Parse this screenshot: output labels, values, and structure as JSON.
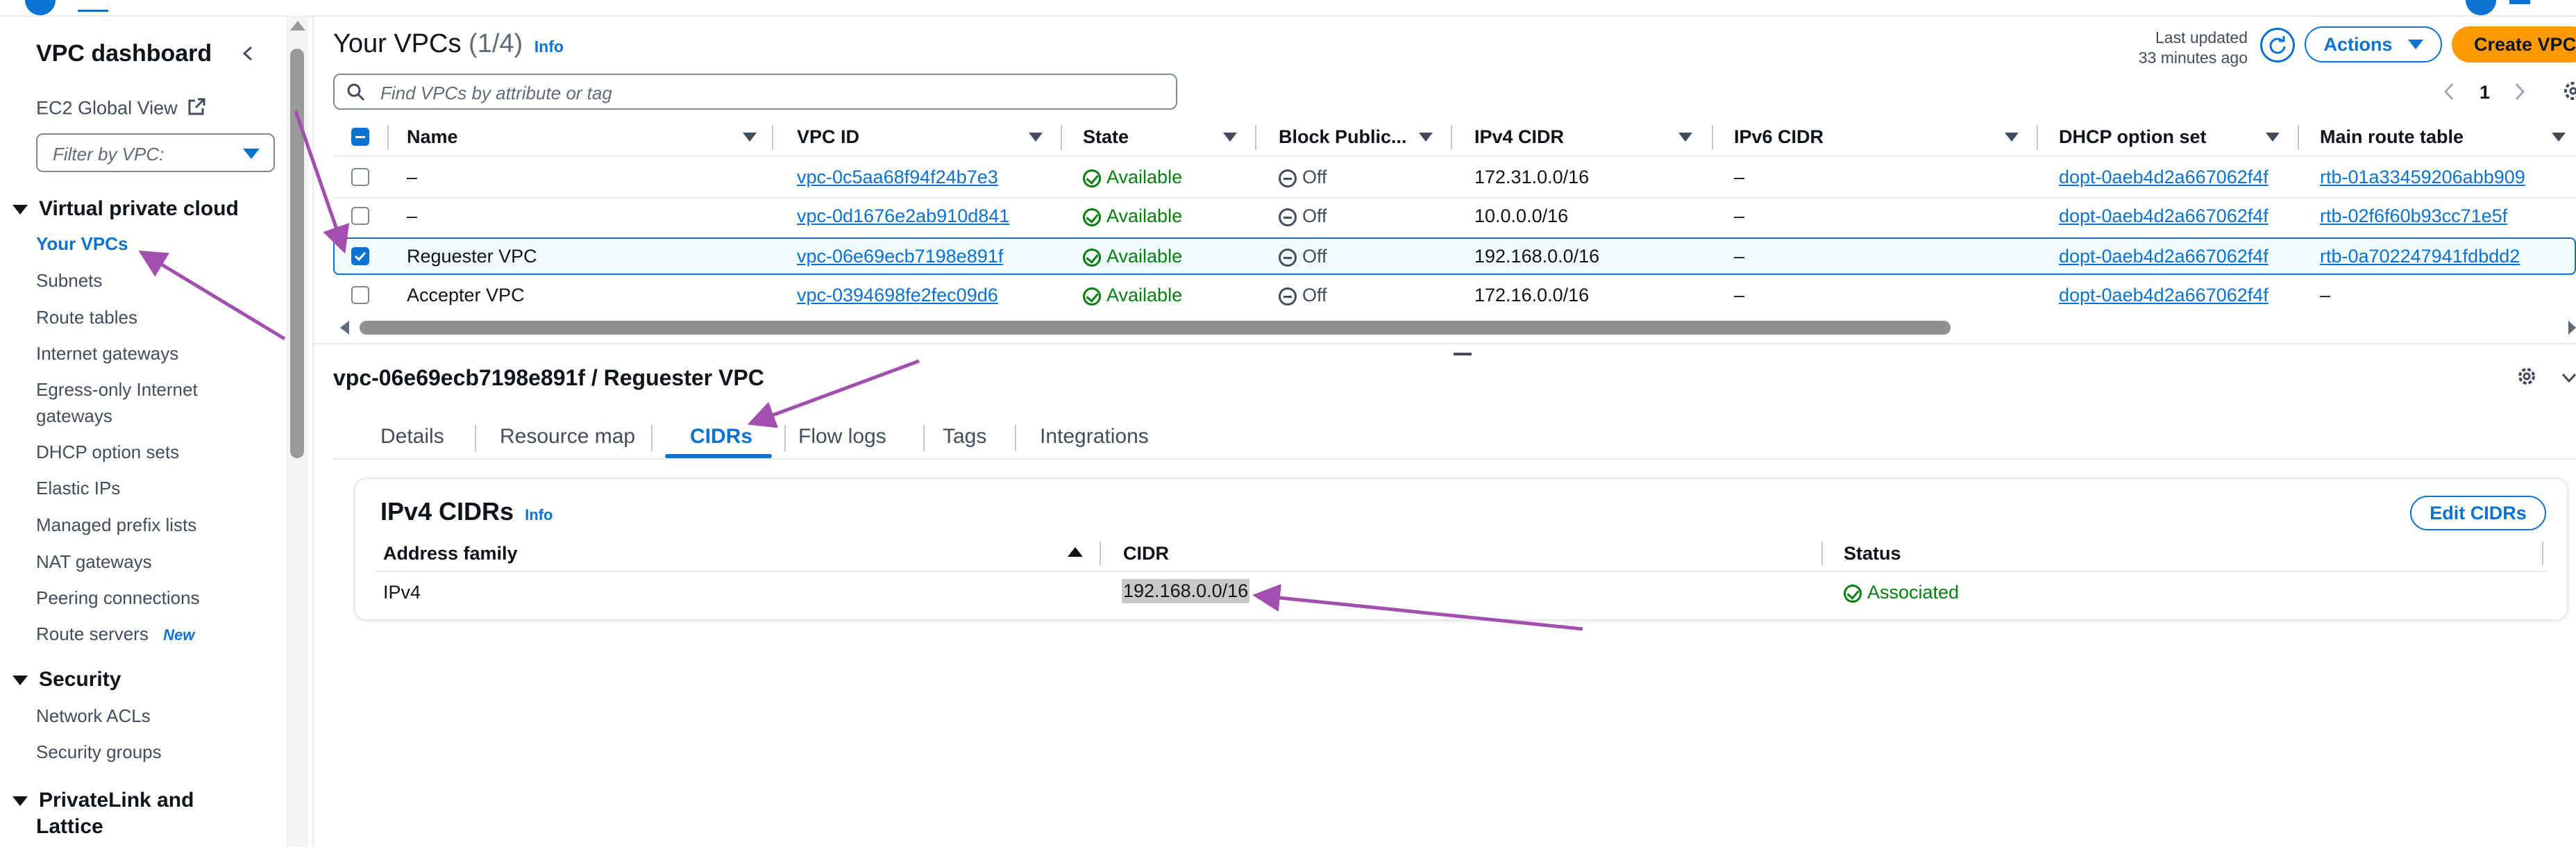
{
  "sidebar": {
    "title": "VPC dashboard",
    "ec2_global_view": "EC2 Global View",
    "filter_placeholder": "Filter by VPC:",
    "sections": [
      {
        "title": "Virtual private cloud",
        "items": [
          {
            "label": "Your VPCs"
          },
          {
            "label": "Subnets"
          },
          {
            "label": "Route tables"
          },
          {
            "label": "Internet gateways"
          },
          {
            "label": "Egress-only Internet"
          },
          {
            "label": "gateways"
          },
          {
            "label": "DHCP option sets"
          },
          {
            "label": "Elastic IPs"
          },
          {
            "label": "Managed prefix lists"
          },
          {
            "label": "NAT gateways"
          },
          {
            "label": "Peering connections"
          },
          {
            "label": "Route servers",
            "badge": "New"
          }
        ]
      },
      {
        "title": "Security",
        "items": [
          {
            "label": "Network ACLs"
          },
          {
            "label": "Security groups"
          }
        ]
      },
      {
        "title_line1": "PrivateLink and",
        "title_line2": "Lattice"
      }
    ]
  },
  "header": {
    "title": "Your VPCs",
    "count": "(1/4)",
    "info": "Info",
    "last_updated_line1": "Last updated",
    "last_updated_line2": "33 minutes ago",
    "actions_label": "Actions",
    "create_label": "Create VPC",
    "search_placeholder": "Find VPCs by attribute or tag",
    "page_number": "1"
  },
  "table": {
    "columns": [
      "Name",
      "VPC ID",
      "State",
      "Block Public...",
      "IPv4 CIDR",
      "IPv6 CIDR",
      "DHCP option set",
      "Main route table"
    ],
    "rows": [
      {
        "name": "–",
        "vpc_id": "vpc-0c5aa68f94f24b7e3",
        "state": "Available",
        "block": "Off",
        "ipv4": "172.31.0.0/16",
        "ipv6": "–",
        "dhcp": "dopt-0aeb4d2a667062f4f",
        "route": "rtb-01a33459206abb909",
        "selected": false
      },
      {
        "name": "–",
        "vpc_id": "vpc-0d1676e2ab910d841",
        "state": "Available",
        "block": "Off",
        "ipv4": "10.0.0.0/16",
        "ipv6": "–",
        "dhcp": "dopt-0aeb4d2a667062f4f",
        "route": "rtb-02f6f60b93cc71e5f",
        "selected": false
      },
      {
        "name": "Reguester VPC",
        "vpc_id": "vpc-06e69ecb7198e891f",
        "state": "Available",
        "block": "Off",
        "ipv4": "192.168.0.0/16",
        "ipv6": "–",
        "dhcp": "dopt-0aeb4d2a667062f4f",
        "route": "rtb-0a702247941fdbdd2",
        "selected": true
      },
      {
        "name": "Accepter VPC",
        "vpc_id": "vpc-0394698fe2fec09d6",
        "state": "Available",
        "block": "Off",
        "ipv4": "172.16.0.0/16",
        "ipv6": "–",
        "dhcp": "dopt-0aeb4d2a667062f4f",
        "route": "–",
        "selected": false
      }
    ]
  },
  "detail": {
    "title": "vpc-06e69ecb7198e891f / Reguester VPC",
    "tabs": [
      "Details",
      "Resource map",
      "CIDRs",
      "Flow logs",
      "Tags",
      "Integrations"
    ],
    "active_tab": "CIDRs",
    "panel": {
      "title": "IPv4 CIDRs",
      "info": "Info",
      "edit_label": "Edit CIDRs",
      "columns": [
        "Address family",
        "CIDR",
        "Status"
      ],
      "row": {
        "family": "IPv4",
        "cidr": "192.168.0.0/16",
        "status": "Associated"
      }
    }
  },
  "colors": {
    "accent": "#0972d3",
    "primary_button": "#ff9900",
    "success": "#037f0c",
    "annotation_arrow": "#a24fb0"
  }
}
